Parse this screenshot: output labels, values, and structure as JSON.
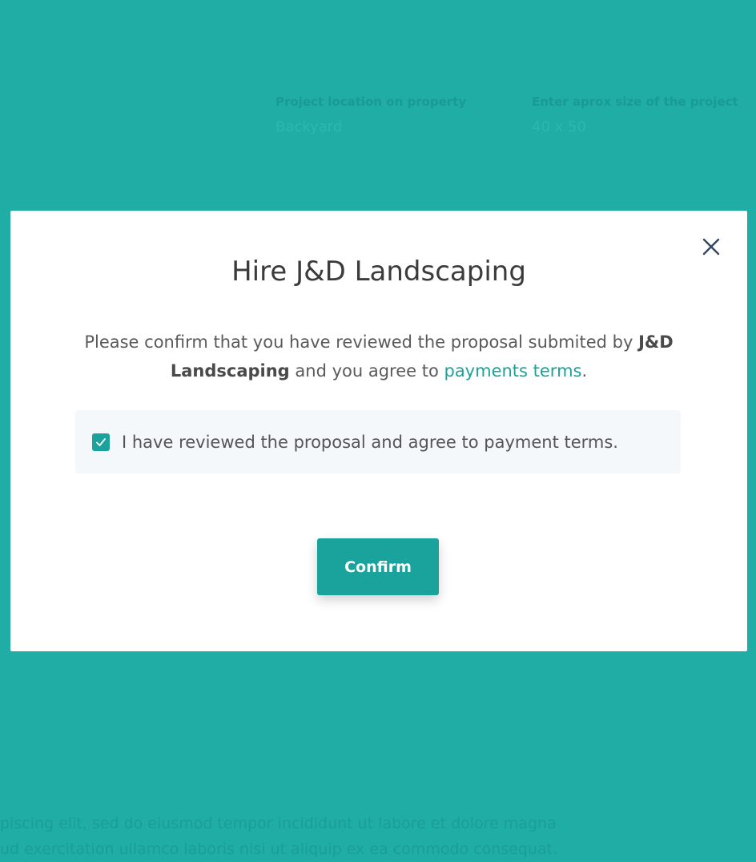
{
  "background": {
    "fields": [
      {
        "label": "Project location on property",
        "value": "Backyard"
      },
      {
        "label": "Enter aprox size of the project",
        "value": "40 x 50"
      }
    ],
    "body_lines": [
      "piscing elit, sed do eiusmod tempor incididunt ut labore et dolore magna",
      "ud exercitation ullamco laboris nisi ut aliquip ex ea commodo consequat."
    ]
  },
  "modal": {
    "title": "Hire J&D Landscaping",
    "desc_prefix": "Please confirm that you have reviewed the proposal submited by ",
    "desc_company": "J&D Landscaping",
    "desc_middle": " and you agree to ",
    "desc_link": "payments terms",
    "desc_suffix": ".",
    "agree_checked": true,
    "agree_label": "I have reviewed the proposal and agree to payment terms.",
    "confirm_label": "Confirm",
    "close_icon": "close-icon"
  },
  "colors": {
    "overlay": "#1fada6",
    "accent": "#1aa39c",
    "text": "#3b3b3b"
  }
}
